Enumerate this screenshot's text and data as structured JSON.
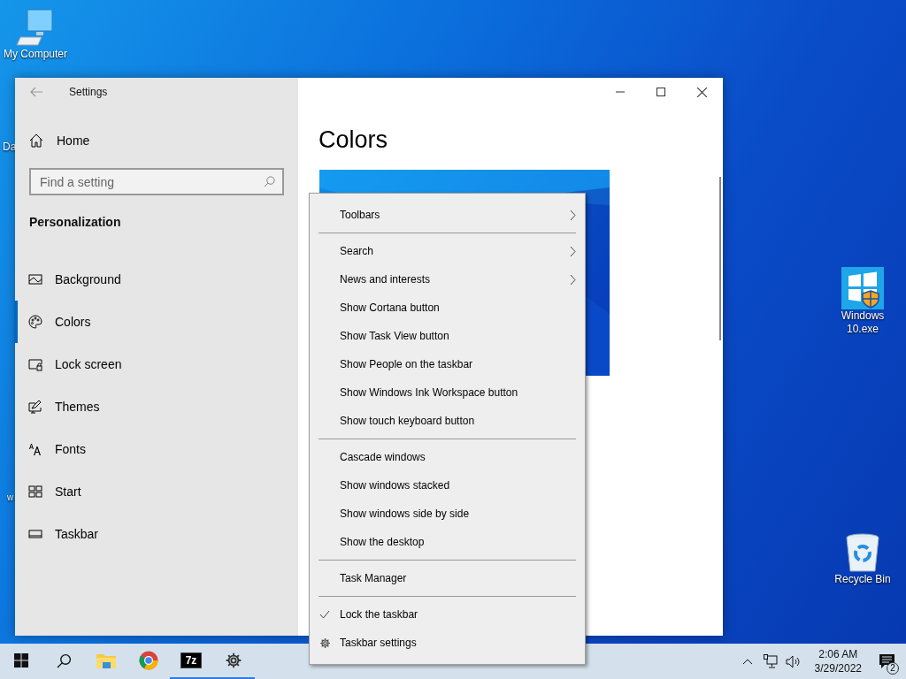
{
  "desktop_icons": [
    {
      "kind": "computer",
      "label": "My Computer"
    },
    {
      "kind": "installer",
      "label": "Windows 10.exe"
    },
    {
      "kind": "recycle",
      "label": "Recycle Bin"
    }
  ],
  "hidden_labels": [
    "Da",
    "w"
  ],
  "window": {
    "title": "Settings",
    "sidebar": {
      "home": "Home",
      "search": {
        "placeholder": "Find a setting"
      },
      "section": "Personalization",
      "items": [
        {
          "label": "Background",
          "selected": false
        },
        {
          "label": "Colors",
          "selected": true
        },
        {
          "label": "Lock screen",
          "selected": false
        },
        {
          "label": "Themes",
          "selected": false
        },
        {
          "label": "Fonts",
          "selected": false
        },
        {
          "label": "Start",
          "selected": false
        },
        {
          "label": "Taskbar",
          "selected": false
        }
      ]
    },
    "content": {
      "heading": "Colors"
    }
  },
  "context_menu": {
    "groups": [
      [
        {
          "label": "Toolbars",
          "kind": "submenu",
          "checked": false
        }
      ],
      [
        {
          "label": "Search",
          "kind": "submenu",
          "checked": false
        },
        {
          "label": "News and interests",
          "kind": "submenu",
          "checked": false
        },
        {
          "label": "Show Cortana button",
          "kind": "item",
          "checked": false
        },
        {
          "label": "Show Task View button",
          "kind": "item",
          "checked": false
        },
        {
          "label": "Show People on the taskbar",
          "kind": "item",
          "checked": false
        },
        {
          "label": "Show Windows Ink Workspace button",
          "kind": "item",
          "checked": false
        },
        {
          "label": "Show touch keyboard button",
          "kind": "item",
          "checked": false
        }
      ],
      [
        {
          "label": "Cascade windows",
          "kind": "item",
          "checked": false
        },
        {
          "label": "Show windows stacked",
          "kind": "item",
          "checked": false
        },
        {
          "label": "Show windows side by side",
          "kind": "item",
          "checked": false
        },
        {
          "label": "Show the desktop",
          "kind": "item",
          "checked": false
        }
      ],
      [
        {
          "label": "Task Manager",
          "kind": "item",
          "checked": false
        }
      ],
      [
        {
          "label": "Lock the taskbar",
          "kind": "item",
          "checked": true
        },
        {
          "label": "Taskbar settings",
          "kind": "settings",
          "checked": false
        }
      ]
    ]
  },
  "taskbar": {
    "apps": [
      {
        "kind": "start",
        "running": false
      },
      {
        "kind": "search",
        "running": false
      },
      {
        "kind": "explorer",
        "running": false
      },
      {
        "kind": "chrome",
        "running": false
      },
      {
        "kind": "archiver",
        "label": "7z",
        "running": true
      },
      {
        "kind": "settings",
        "running": true
      }
    ],
    "clock": {
      "time": "2:06 AM",
      "date": "3/29/2022"
    },
    "notifications": {
      "count": "2"
    }
  }
}
